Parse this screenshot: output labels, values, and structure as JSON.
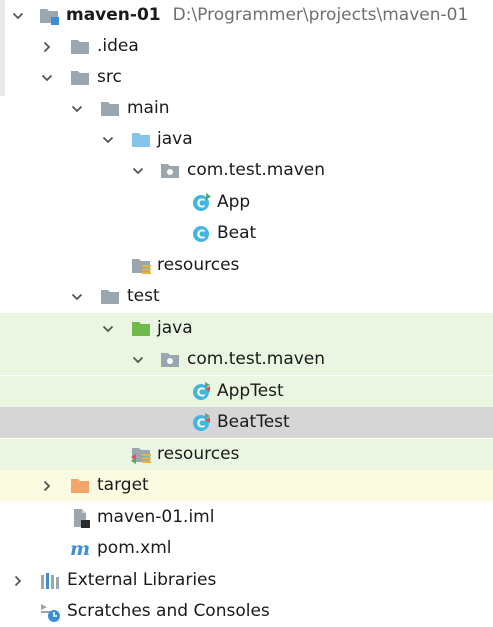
{
  "project": {
    "name": "maven-01",
    "path": "D:\\Programmer\\projects\\maven-01"
  },
  "tree": {
    "idea": ".idea",
    "src": "src",
    "main": "main",
    "main_java": "java",
    "main_package": "com.test.maven",
    "app": "App",
    "beat": "Beat",
    "main_resources": "resources",
    "test": "test",
    "test_java": "java",
    "test_package": "com.test.maven",
    "app_test": "AppTest",
    "beat_test": "BeatTest",
    "test_resources": "resources",
    "target": "target",
    "iml": "maven-01.iml",
    "pom": "pom.xml",
    "external_libraries": "External Libraries",
    "scratches": "Scratches and Consoles"
  },
  "colors": {
    "folder_gray": "#9aa7b0",
    "source_blue": "#87c5e8",
    "test_green": "#6fba4d",
    "excluded_orange": "#f4a36a",
    "class_blue": "#40b6e0",
    "selection": "#d6d6d6",
    "test_highlight": "#eaf6e1",
    "excluded_highlight": "#fbfbe2"
  }
}
